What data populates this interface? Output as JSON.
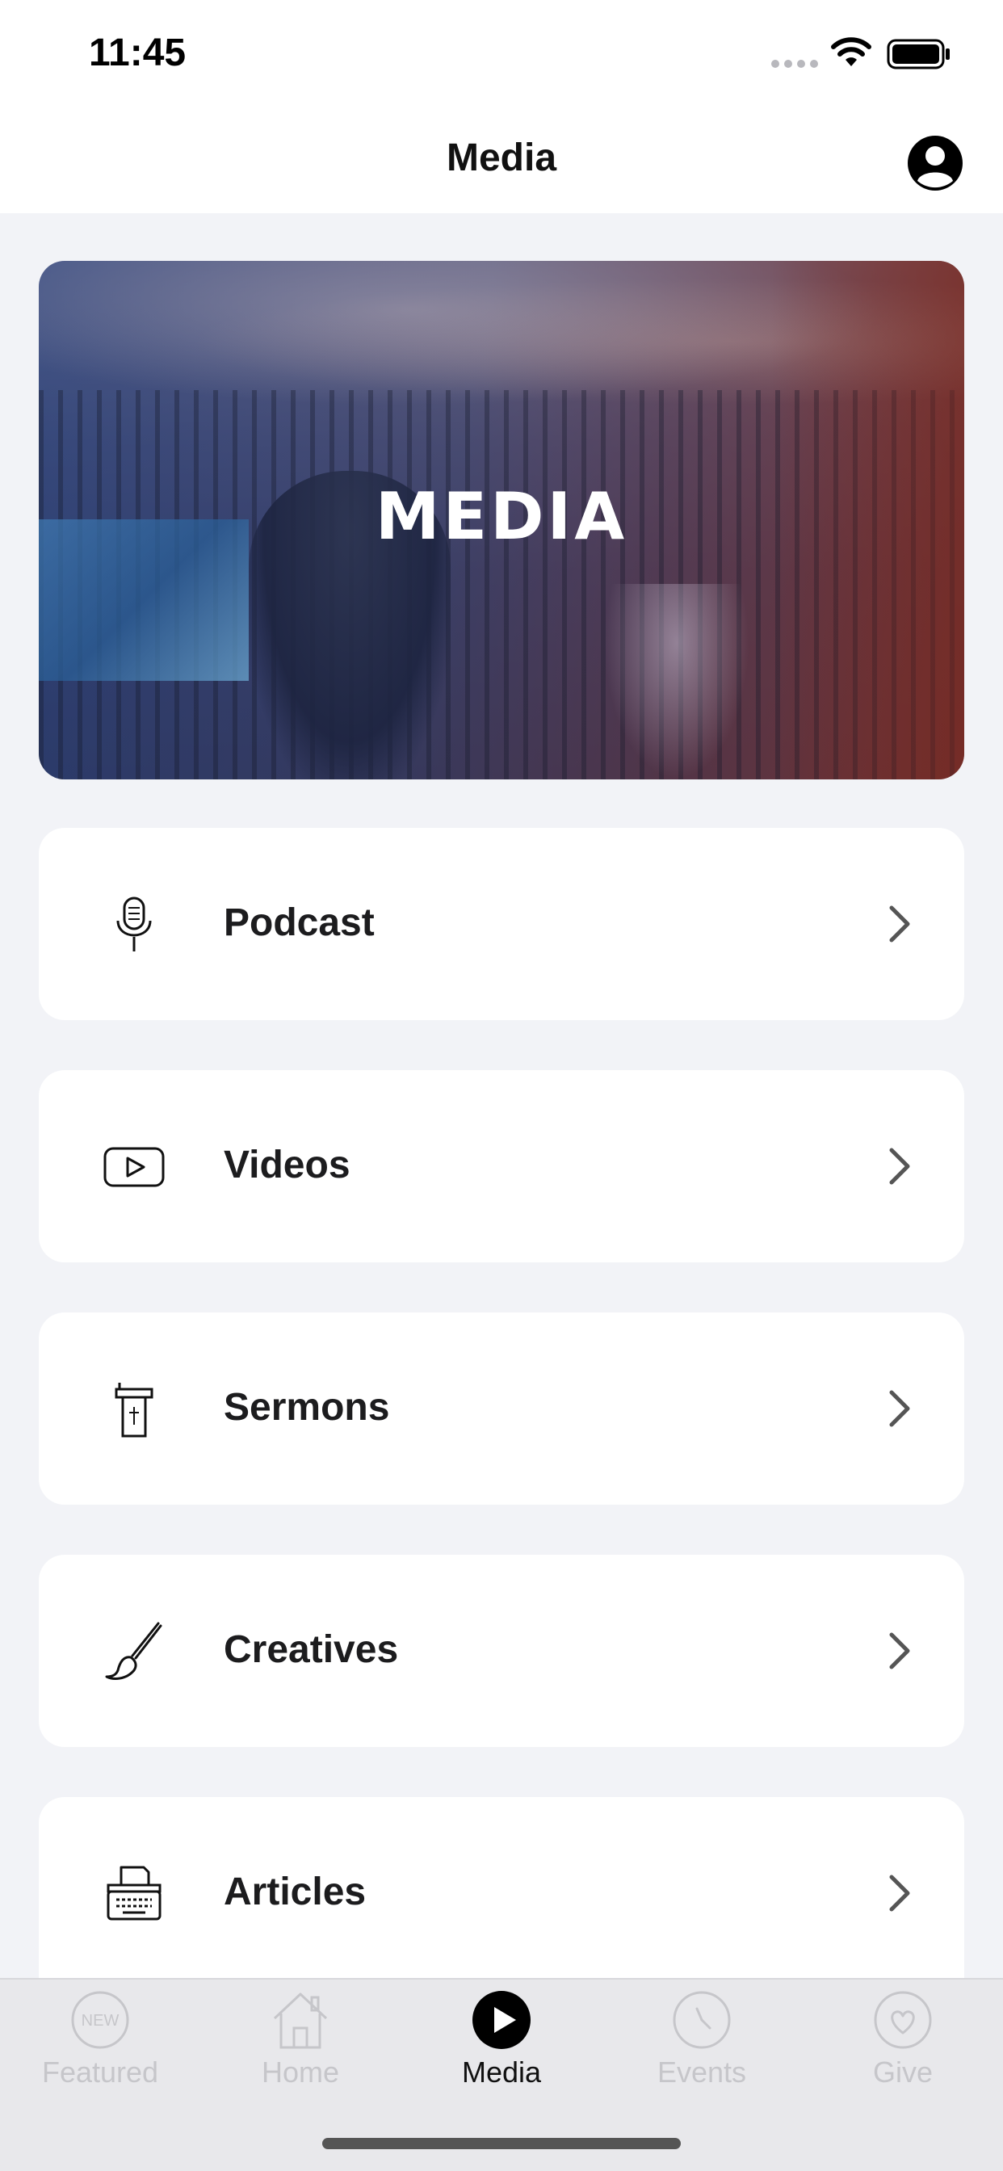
{
  "status_bar": {
    "time": "11:45",
    "icons": [
      "signal-dots-icon",
      "wifi-icon",
      "battery-icon"
    ]
  },
  "nav": {
    "title": "Media",
    "right_icon": "profile-icon"
  },
  "hero": {
    "title": "MEDIA"
  },
  "menu": {
    "items": [
      {
        "label": "Podcast",
        "icon": "microphone-icon"
      },
      {
        "label": "Videos",
        "icon": "video-play-icon"
      },
      {
        "label": "Sermons",
        "icon": "pulpit-icon"
      },
      {
        "label": "Creatives",
        "icon": "paintbrush-icon"
      },
      {
        "label": "Articles",
        "icon": "typewriter-icon"
      }
    ],
    "chevron_icon": "chevron-right-icon"
  },
  "tab_bar": {
    "tabs": [
      {
        "label": "Featured",
        "icon": "new-badge-icon",
        "active": false
      },
      {
        "label": "Home",
        "icon": "home-icon",
        "active": false
      },
      {
        "label": "Media",
        "icon": "play-circle-icon",
        "active": true
      },
      {
        "label": "Events",
        "icon": "clock-icon",
        "active": false
      },
      {
        "label": "Give",
        "icon": "heart-icon",
        "active": false
      }
    ],
    "featured_badge_text": "NEW"
  },
  "colors": {
    "background": "#f2f3f7",
    "card": "#ffffff",
    "tab_bar": "#e8e8eb",
    "active_tab": "#111111",
    "inactive_tab": "#c6c6ca"
  }
}
